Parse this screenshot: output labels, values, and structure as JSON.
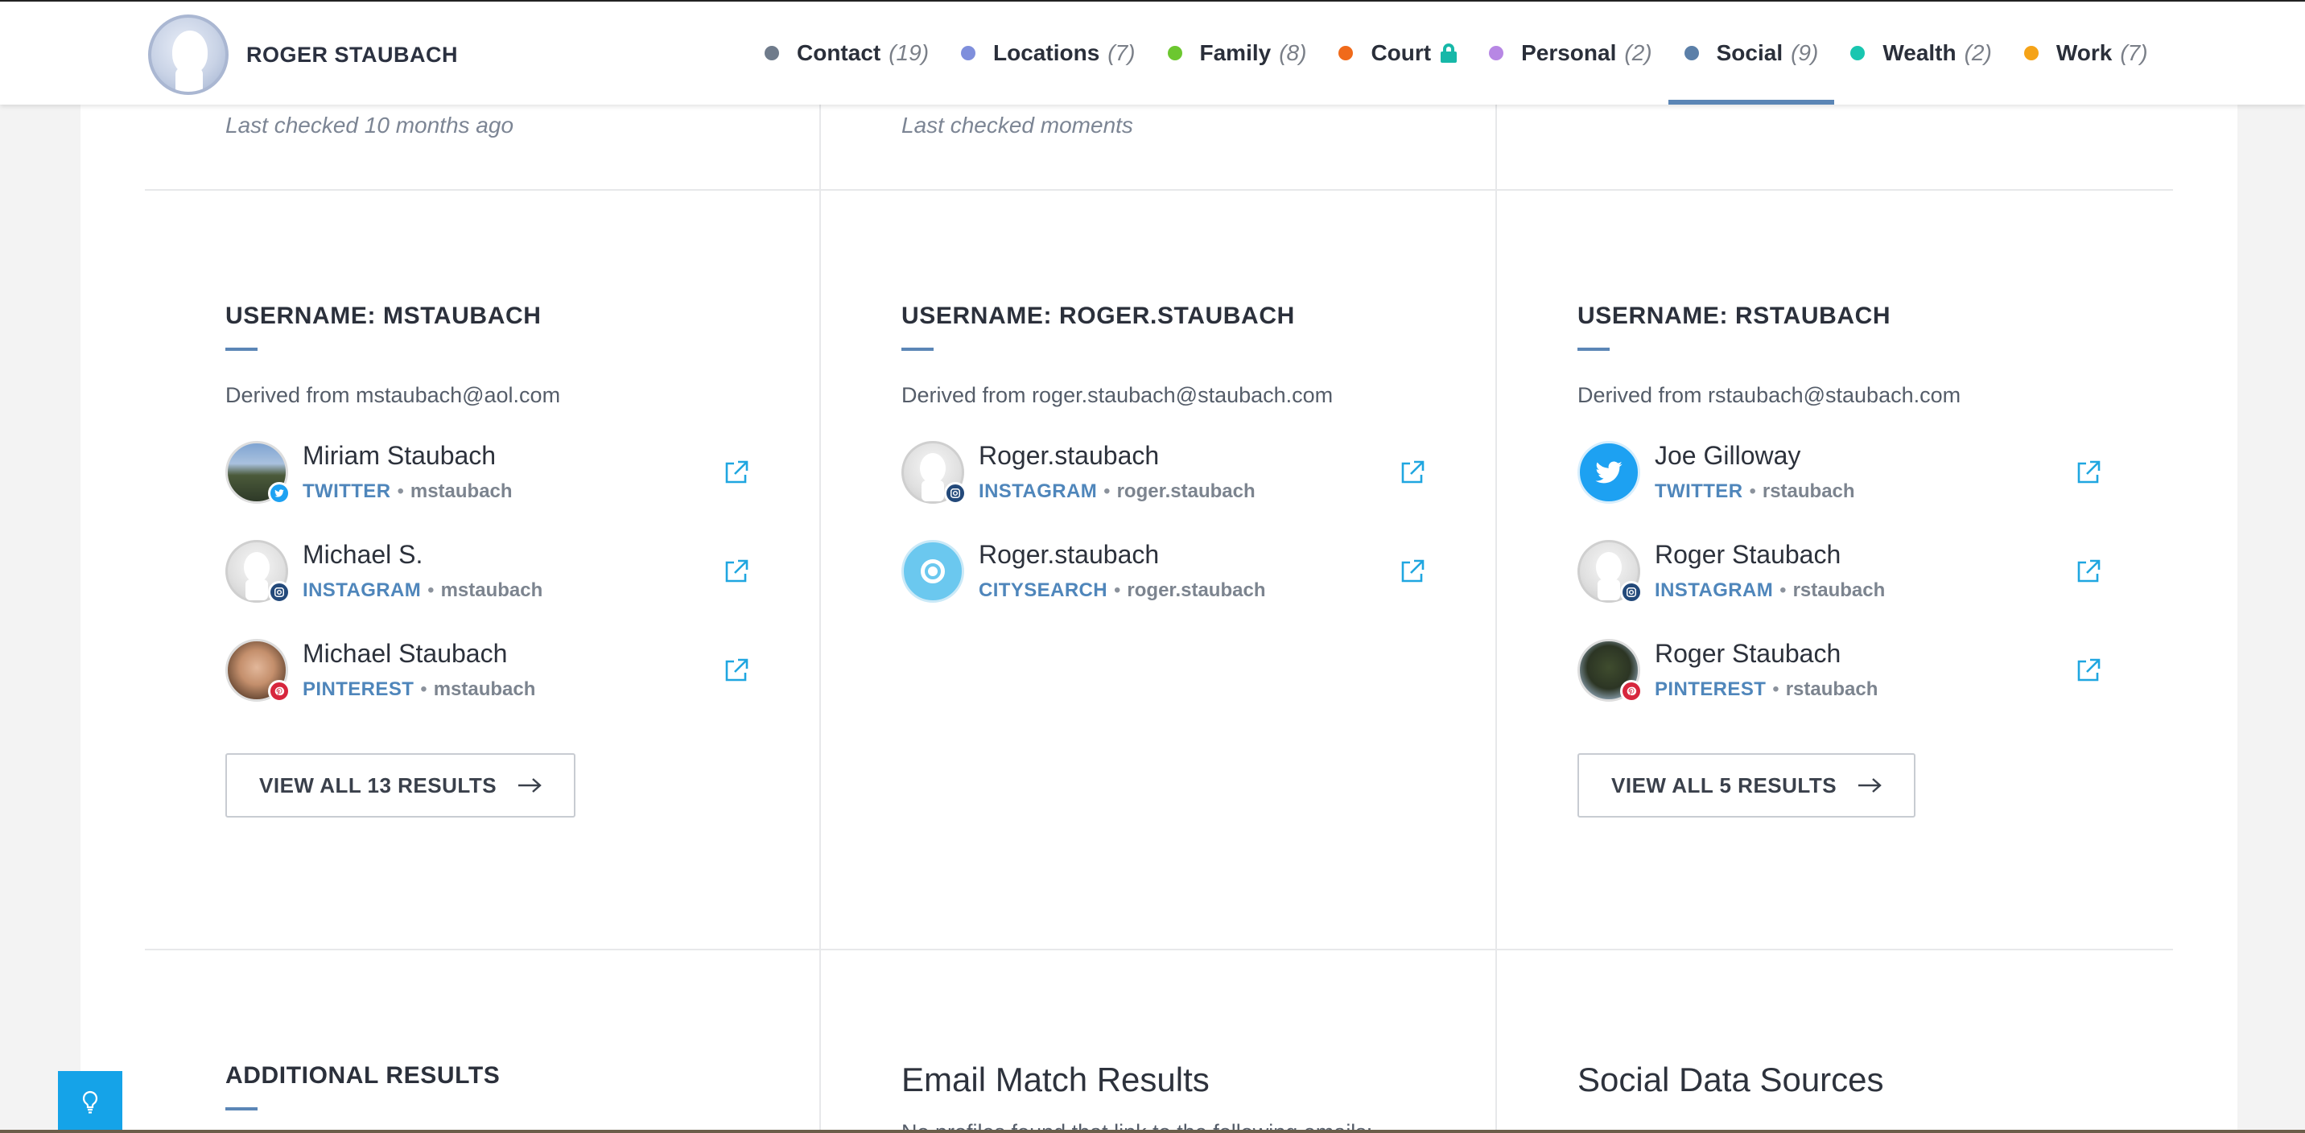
{
  "header": {
    "profile_name": "ROGER STAUBACH",
    "nav": [
      {
        "label": "Contact",
        "count": "(19)",
        "color": "#6f7b8b"
      },
      {
        "label": "Locations",
        "count": "(7)",
        "color": "#7f8fdc"
      },
      {
        "label": "Family",
        "count": "(8)",
        "color": "#6cc72f"
      },
      {
        "label": "Court",
        "count": "",
        "color": "#f06a1a",
        "locked": true
      },
      {
        "label": "Personal",
        "count": "(2)",
        "color": "#b787e4"
      },
      {
        "label": "Social",
        "count": "(9)",
        "color": "#5b7fa8",
        "active": true
      },
      {
        "label": "Wealth",
        "count": "(2)",
        "color": "#19c6b0"
      },
      {
        "label": "Work",
        "count": "(7)",
        "color": "#f5a318"
      }
    ]
  },
  "last_checked": [
    "Last checked 10 months ago",
    "Last checked moments"
  ],
  "sections": [
    {
      "title": "USERNAME: MSTAUBACH",
      "derived": "Derived from mstaubach@aol.com",
      "results": [
        {
          "name": "Miriam Staubach",
          "network": "TWITTER",
          "username": "mstaubach",
          "avatar": "mountain",
          "badge": "twitter"
        },
        {
          "name": "Michael S.",
          "network": "INSTAGRAM",
          "username": "mstaubach",
          "avatar": "gray",
          "badge": "instagram"
        },
        {
          "name": "Michael Staubach",
          "network": "PINTEREST",
          "username": "mstaubach",
          "avatar": "face",
          "badge": "pinterest"
        }
      ],
      "view_all": "VIEW ALL 13 RESULTS"
    },
    {
      "title": "USERNAME: ROGER.STAUBACH",
      "derived": "Derived from roger.staubach@staubach.com",
      "results": [
        {
          "name": "Roger.staubach",
          "network": "INSTAGRAM",
          "username": "roger.staubach",
          "avatar": "gray",
          "badge": "instagram"
        },
        {
          "name": "Roger.staubach",
          "network": "CITYSEARCH",
          "username": "roger.staubach",
          "avatar": "citysearch",
          "badge": ""
        }
      ],
      "view_all": ""
    },
    {
      "title": "USERNAME: RSTAUBACH",
      "derived": "Derived from rstaubach@staubach.com",
      "results": [
        {
          "name": "Joe Gilloway",
          "network": "TWITTER",
          "username": "rstaubach",
          "avatar": "twitterbig",
          "badge": ""
        },
        {
          "name": "Roger Staubach",
          "network": "INSTAGRAM",
          "username": "rstaubach",
          "avatar": "gray",
          "badge": "instagram"
        },
        {
          "name": "Roger Staubach",
          "network": "PINTEREST",
          "username": "rstaubach",
          "avatar": "statue",
          "badge": "pinterest"
        }
      ],
      "view_all": "VIEW ALL 5 RESULTS"
    }
  ],
  "bottom": {
    "additional_title": "ADDITIONAL RESULTS",
    "email_match_title": "Email Match Results",
    "email_match_sub": "No profiles found that link to the following emails:",
    "social_sources_title": "Social Data Sources"
  },
  "colors": {
    "accent": "#5b86b6",
    "link": "#4f86bb",
    "help": "#15a3e8"
  },
  "icons": [
    "external-link-icon",
    "arrow-right-icon",
    "lightbulb-icon",
    "lock-icon",
    "twitter-icon",
    "instagram-icon",
    "pinterest-icon"
  ]
}
